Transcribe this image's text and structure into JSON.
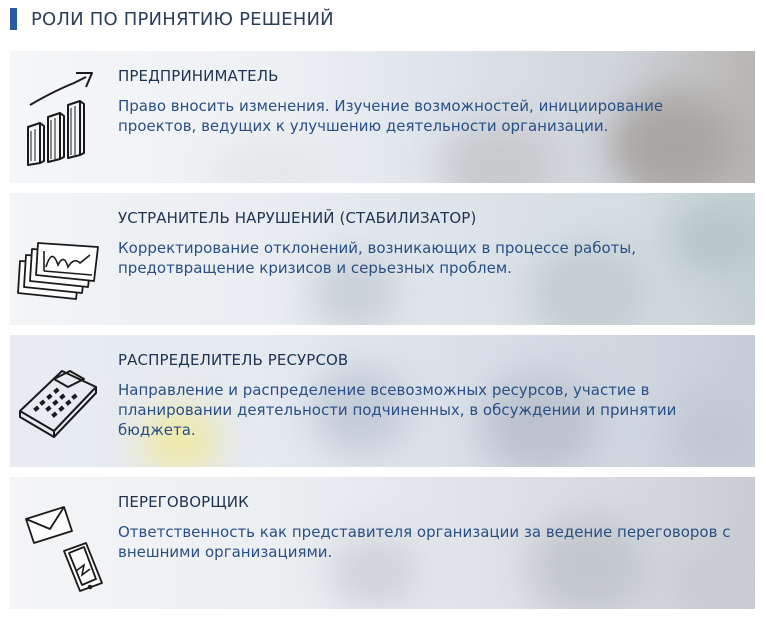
{
  "header": {
    "title": "РОЛИ ПО ПРИНЯТИЮ РЕШЕНИЙ"
  },
  "roles": [
    {
      "icon": "growth-chart-icon",
      "title": "ПРЕДПРИНИМАТЕЛЬ",
      "text": "Право вносить изменения. Изучение возможностей, инициирование проектов, ведущих к улучшению деятельности организации."
    },
    {
      "icon": "line-chart-stack-icon",
      "title": "УСТРАНИТЕЛЬ НАРУШЕНИЙ (СТАБИЛИЗАТОР)",
      "text": "Корректирование отклонений, возникающих в процессе работы, предотвращение кризисов и серьезных проблем."
    },
    {
      "icon": "calculator-icon",
      "title": "РАСПРЕДЕЛИТЕЛЬ РЕСУРСОВ",
      "text": "Направление и распределение всевозможных ресурсов, участие в планировании деятельности подчиненных, в обсуждении и принятии бюджета."
    },
    {
      "icon": "envelope-phone-icon",
      "title": "ПЕРЕГОВОРЩИК",
      "text": "Ответственность как представителя организации за ведение переговоров с внешними организациями."
    }
  ],
  "colors": {
    "accent": "#2a5aa0",
    "title": "#1f3350",
    "text": "#2a4f86"
  }
}
